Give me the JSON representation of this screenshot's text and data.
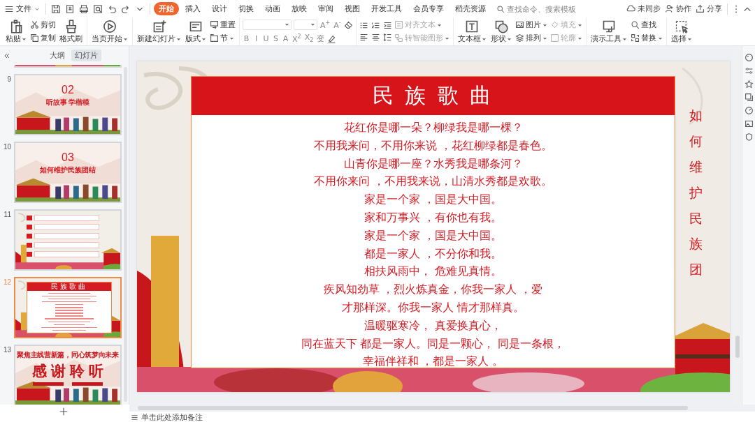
{
  "menu": {
    "label": "文件"
  },
  "tabs": [
    {
      "label": "开始",
      "selected": true
    },
    {
      "label": "插入",
      "selected": false
    },
    {
      "label": "设计",
      "selected": false
    },
    {
      "label": "切换",
      "selected": false
    },
    {
      "label": "动画",
      "selected": false
    },
    {
      "label": "放映",
      "selected": false
    },
    {
      "label": "审阅",
      "selected": false
    },
    {
      "label": "视图",
      "selected": false
    },
    {
      "label": "开发工具",
      "selected": false
    },
    {
      "label": "会员专享",
      "selected": false
    },
    {
      "label": "稻壳资源",
      "selected": false
    }
  ],
  "search": {
    "placeholder": "查找命令、搜索模板"
  },
  "account_actions": [
    "未同步",
    "协作",
    "分享"
  ],
  "ribbon": [
    [
      {
        "kind": "large",
        "label": "粘贴",
        "dropdown": true,
        "disabled": false
      },
      {
        "kind": "stack",
        "items": [
          {
            "label": "剪切",
            "dropdown": false,
            "disabled": false
          },
          {
            "label": "复制",
            "dropdown": false,
            "disabled": false
          }
        ]
      },
      {
        "kind": "large",
        "label": "格式刷",
        "dropdown": false,
        "disabled": false
      }
    ],
    [
      {
        "kind": "large",
        "label": "当页开始",
        "dropdown": true,
        "disabled": false
      }
    ],
    [
      {
        "kind": "large",
        "label": "新建幻灯片",
        "dropdown": true,
        "disabled": false
      },
      {
        "kind": "large",
        "label": "版式",
        "dropdown": true,
        "disabled": false
      },
      {
        "kind": "stack",
        "items": [
          {
            "label": "重置",
            "dropdown": false,
            "disabled": false
          },
          {
            "label": "节",
            "dropdown": true,
            "disabled": false
          }
        ]
      }
    ],
    [
      {
        "kind": "font",
        "row1": [
          "A$^{+}$",
          "A$^{-}$"
        ],
        "row2": [
          "B",
          "I",
          "U",
          "S",
          "A",
          "X$^{2}$",
          "X$_{2}$",
          "变"
        ]
      }
    ],
    [
      {
        "kind": "paragraph"
      },
      {
        "kind": "stack",
        "items": [
          {
            "label": "对齐文本",
            "dropdown": true,
            "disabled": true
          },
          {
            "label": "转智能图形",
            "dropdown": true,
            "disabled": true
          }
        ]
      }
    ],
    [
      {
        "kind": "large",
        "label": "文本框",
        "dropdown": true,
        "disabled": false
      },
      {
        "kind": "large",
        "label": "形状",
        "dropdown": true,
        "disabled": false
      },
      {
        "kind": "stack",
        "items": [
          {
            "label": "图片",
            "dropdown": true,
            "disabled": false
          },
          {
            "label": "排列",
            "dropdown": true,
            "disabled": false
          }
        ]
      },
      {
        "kind": "stack",
        "items": [
          {
            "label": "填充",
            "dropdown": true,
            "disabled": true
          },
          {
            "label": "轮廓",
            "dropdown": true,
            "disabled": true
          }
        ]
      }
    ],
    [
      {
        "kind": "large",
        "label": "演示工具",
        "dropdown": true,
        "disabled": false
      },
      {
        "kind": "stack",
        "items": [
          {
            "label": "查找",
            "dropdown": false,
            "disabled": false
          },
          {
            "label": "替换",
            "dropdown": true,
            "disabled": false
          }
        ]
      }
    ],
    [
      {
        "kind": "large",
        "label": "选择",
        "dropdown": true,
        "disabled": false
      }
    ]
  ],
  "panel_tabs": [
    {
      "label": "大纲",
      "selected": false
    },
    {
      "label": "幻灯片",
      "selected": true
    }
  ],
  "slides": [
    {
      "kind": "partial",
      "selected": false
    },
    {
      "kind": "chapter",
      "number": "9",
      "selected": false,
      "heading": "02",
      "subtitle": "听故事  学楷模"
    },
    {
      "kind": "chapter",
      "number": "10",
      "selected": false,
      "heading": "03",
      "subtitle": "如何维护民族团结"
    },
    {
      "kind": "list",
      "number": "11",
      "selected": false
    },
    {
      "kind": "lyrics",
      "number": "12",
      "selected": true,
      "title": "民族歌曲"
    },
    {
      "kind": "closing",
      "number": "13",
      "selected": false,
      "tagline": "聚焦主线营新篇，同心筑梦向未来",
      "heading": "感 谢 聆 听"
    }
  ],
  "slide": {
    "title": "民 族 歌 曲",
    "lines": [
      "花红你是哪一朵？柳绿我是哪一棵？",
      "不用我来问，不用你来说 ，花红柳绿都是春色。",
      "山青你是哪一座？水秀我是哪条河？",
      "不用你来问 ，不用我来说，山清水秀都是欢歌。",
      "家是一个家 ，国是大中国。",
      "家和万事兴 ，有你也有我。",
      "家是一个家 ，国是大中国。",
      "都是一家人 ，不分你和我。",
      "相扶风雨中， 危难见真情。",
      "疾风知劲草 ，烈火炼真金，你我一家人 ，爱",
      "才那样深。你我一家人 情才那样真。",
      "温暖驱寒冷， 真爱换真心，",
      "同在蓝天下 都是一家人。同是一颗心， 同是一条根，",
      "幸福伴祥和 ，都是一家人 。"
    ],
    "vertical_caption": "如何维护民族团"
  },
  "notes": {
    "placeholder": "单击此处添加备注"
  }
}
